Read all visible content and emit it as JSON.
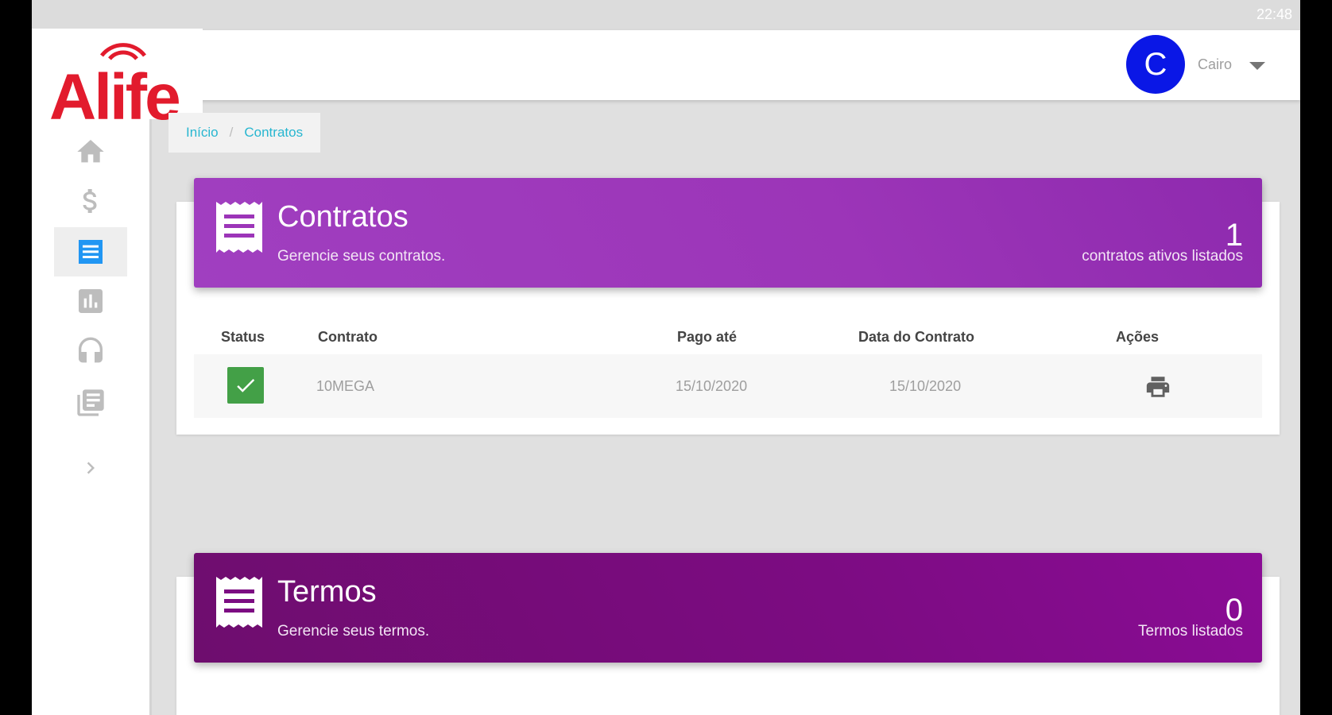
{
  "statusbar": {
    "time": "22:48"
  },
  "brand": {
    "logo_text": "Alife",
    "color": "#e21b2d"
  },
  "user": {
    "avatar_initial": "C",
    "name": "Cairo",
    "avatar_color": "#0a17e6"
  },
  "sidebar": {
    "items": [
      {
        "icon": "home-icon",
        "active": false
      },
      {
        "icon": "dollar-icon",
        "active": false
      },
      {
        "icon": "contracts-list-icon",
        "active": true
      },
      {
        "icon": "chart-icon",
        "active": false
      },
      {
        "icon": "headset-icon",
        "active": false
      },
      {
        "icon": "documents-icon",
        "active": false
      }
    ],
    "expand_icon": "chevron-right-icon"
  },
  "breadcrumb": {
    "home": "Início",
    "current": "Contratos"
  },
  "contratos": {
    "title": "Contratos",
    "subtitle": "Gerencie seus contratos.",
    "count": "1",
    "count_label": "contratos ativos listados",
    "columns": [
      "Status",
      "Contrato",
      "Pago até",
      "Data do Contrato",
      "Ações"
    ],
    "rows": [
      {
        "status": "active",
        "contrato": "10MEGA",
        "pago_ate": "15/10/2020",
        "data_contrato": "15/10/2020",
        "acao": "print-icon"
      }
    ]
  },
  "termos": {
    "title": "Termos",
    "subtitle": "Gerencie seus termos.",
    "count": "0",
    "count_label": "Termos listados"
  }
}
